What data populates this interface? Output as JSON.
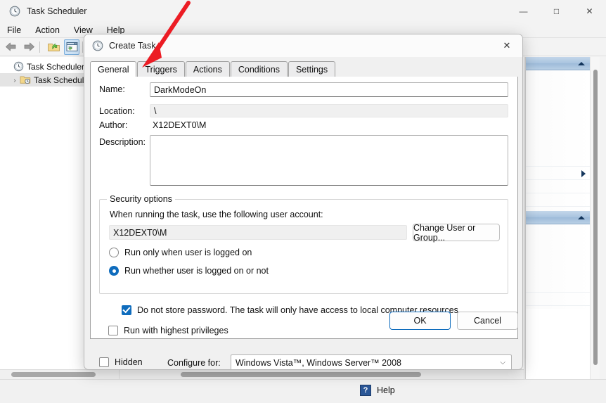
{
  "window": {
    "title": "Task Scheduler",
    "icon": "clock-icon",
    "caption": {
      "minimize": "—",
      "maximize": "□",
      "close": "✕"
    },
    "menus": [
      "File",
      "Action",
      "View",
      "Help"
    ],
    "toolbar": [
      {
        "name": "back-icon",
        "label": "Back"
      },
      {
        "name": "forward-icon",
        "label": "Forward"
      },
      {
        "name": "open-folder-icon",
        "label": "Show/Hide Console Tree"
      },
      {
        "name": "properties-window-icon",
        "label": "Properties",
        "selected": true
      }
    ],
    "tree": [
      {
        "label": "Task Scheduler (L",
        "icon": "clock-icon",
        "expander": "",
        "selected": false
      },
      {
        "label": "Task Schedule",
        "icon": "folder-clock-icon",
        "expander": "›",
        "selected": true
      }
    ],
    "status": {
      "help_label": "Help",
      "help_icon": "question-icon"
    }
  },
  "dialog": {
    "title": "Create Task",
    "icon": "clock-icon",
    "close_glyph": "✕",
    "tabs": [
      {
        "label": "General",
        "active": true
      },
      {
        "label": "Triggers",
        "active": false
      },
      {
        "label": "Actions",
        "active": false
      },
      {
        "label": "Conditions",
        "active": false
      },
      {
        "label": "Settings",
        "active": false
      }
    ],
    "general": {
      "name_label": "Name:",
      "name_value": "DarkModeOn",
      "location_label": "Location:",
      "location_value": "\\",
      "author_label": "Author:",
      "author_value": "X12DEXT0\\M",
      "description_label": "Description:",
      "description_value": "",
      "security": {
        "group_title": "Security options",
        "account_prompt": "When running the task, use the following user account:",
        "account_value": "X12DEXT0\\M",
        "change_user_button": "Change User or Group...",
        "radio_logged_on": {
          "label": "Run only when user is logged on",
          "checked": false
        },
        "radio_whether": {
          "label": "Run whether user is logged on or not",
          "checked": true
        },
        "check_no_password": {
          "label": "Do not store password.  The task will only have access to local computer resources.",
          "checked": true
        },
        "check_highest": {
          "label": "Run with highest privileges",
          "checked": false
        }
      },
      "hidden_check": {
        "label": "Hidden",
        "checked": false
      },
      "configure_label": "Configure for:",
      "configure_value": "Windows Vista™, Windows Server™ 2008",
      "configure_chevron": "⌵"
    },
    "footer": {
      "ok": "OK",
      "cancel": "Cancel"
    }
  },
  "annotation": {
    "arrow_color": "#ec1c24",
    "points_to": "Triggers"
  },
  "colors": {
    "accent": "#0f6cbd",
    "window_bg": "#f3f3f3",
    "pane_header": "#a9c4df",
    "help_icon_bg": "#2b5797"
  }
}
